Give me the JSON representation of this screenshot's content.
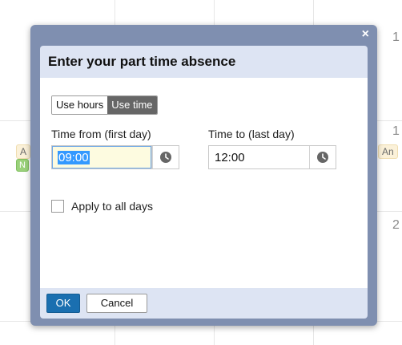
{
  "background": {
    "day_numbers": [
      "1",
      "1",
      "2"
    ],
    "chips": [
      "A",
      "N",
      "An"
    ]
  },
  "dialog": {
    "close_glyph": "×",
    "title": "Enter your part time absence",
    "mode_toggle": {
      "options": [
        "Use hours",
        "Use time"
      ],
      "selected": "Use time"
    },
    "time_from": {
      "label": "Time from (first day)",
      "value": "09:00"
    },
    "time_to": {
      "label": "Time to (last day)",
      "value": "12:00"
    },
    "apply_all_days": {
      "label": "Apply to all days",
      "checked": false
    },
    "buttons": {
      "ok": "OK",
      "cancel": "Cancel"
    }
  },
  "icons": {
    "clock": "clock-icon",
    "close": "close-icon"
  },
  "colors": {
    "overlay_frame": "#7f8fb0",
    "header_bg": "#dde4f3",
    "ok_button": "#1a6fb0",
    "toggle_selected": "#666666",
    "selection_highlight": "#3399ff"
  }
}
